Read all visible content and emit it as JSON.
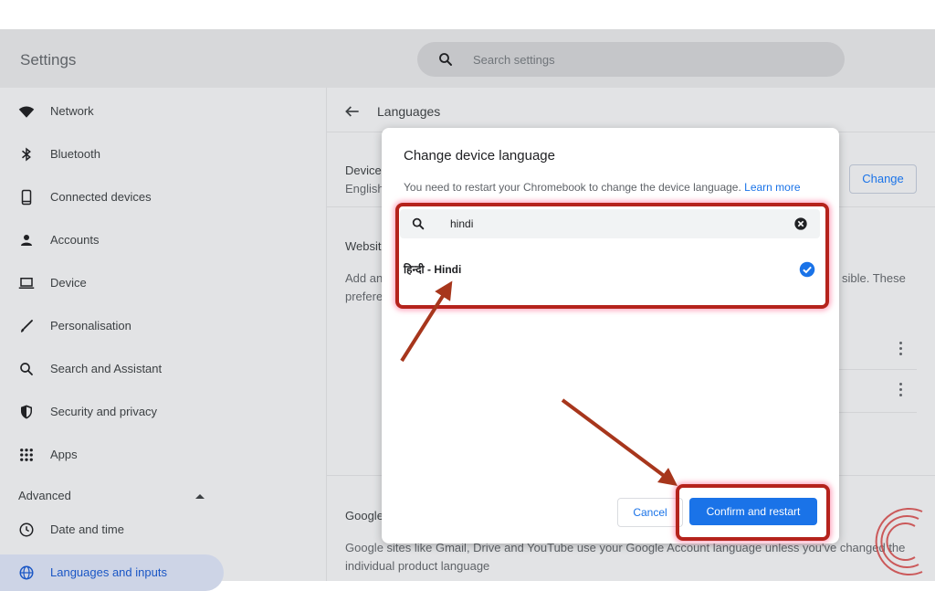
{
  "app": {
    "title": "Settings"
  },
  "search": {
    "placeholder": "Search settings"
  },
  "sidebar": {
    "items": [
      {
        "label": "Network"
      },
      {
        "label": "Bluetooth"
      },
      {
        "label": "Connected devices"
      },
      {
        "label": "Accounts"
      },
      {
        "label": "Device"
      },
      {
        "label": "Personalisation"
      },
      {
        "label": "Search and Assistant"
      },
      {
        "label": "Security and privacy"
      },
      {
        "label": "Apps"
      }
    ],
    "advanced_label": "Advanced",
    "advanced_items": [
      {
        "label": "Date and time"
      },
      {
        "label": "Languages and inputs"
      }
    ]
  },
  "main": {
    "title": "Languages",
    "device_label": "Device",
    "device_value": "English",
    "change_label": "Change",
    "website_label": "Websit",
    "add_text": "Add an",
    "prefer_text": "prefere",
    "visible_text": "sible. These",
    "google_label": "Google",
    "google_desc_line1": "Google sites like Gmail, Drive and YouTube use your Google Account language unless you've changed the",
    "google_desc_line2": "individual product language"
  },
  "dialog": {
    "title": "Change device language",
    "description": "You need to restart your Chromebook to change the device language.",
    "learn_more": "Learn more",
    "search_value": "hindi",
    "result_label": "हिन्दी - Hindi",
    "cancel_label": "Cancel",
    "confirm_label": "Confirm and restart"
  },
  "colors": {
    "accent": "#1a73e8",
    "highlight": "#b5231c",
    "arrow": "#a7361c"
  },
  "icons": {
    "search": "search-icon",
    "network": "wifi-icon",
    "bluetooth": "bluetooth-icon",
    "connected_devices": "phone-icon",
    "accounts": "person-icon",
    "device": "laptop-icon",
    "personalisation": "brush-icon",
    "search_assistant": "search-icon",
    "security": "shield-icon",
    "apps": "grid-icon",
    "date_time": "clock-icon",
    "languages": "globe-icon",
    "back": "arrow-left-icon",
    "clear": "close-circle-icon",
    "selected": "check-circle-icon",
    "more": "more-vert-icon"
  }
}
